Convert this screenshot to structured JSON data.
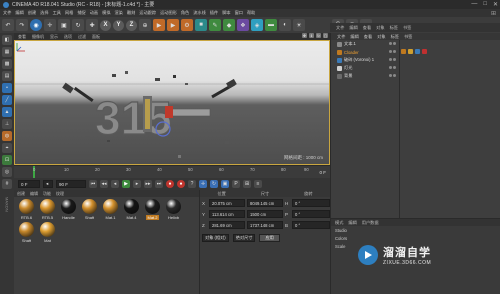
{
  "window": {
    "title": "CINEMA 4D R18.041 Studio (RC - R18) - [未标题-1.c4d *] - 主要",
    "controls": [
      "—",
      "□",
      "✕"
    ]
  },
  "menubar": [
    "文件",
    "编辑",
    "创建",
    "选择",
    "工具",
    "网格",
    "捕捉",
    "动画",
    "模拟",
    "渲染",
    "雕刻",
    "运动跟踪",
    "运动图形",
    "角色",
    "流水线",
    "插件",
    "脚本",
    "窗口",
    "帮助"
  ],
  "toolbar": {
    "xyz": [
      "X",
      "Y",
      "Z"
    ]
  },
  "viewport": {
    "menu": [
      "查看",
      "摄像机",
      "显示",
      "选项",
      "过滤",
      "面板"
    ],
    "grid_label": "网格间距 : 1000 cm",
    "text_3d": "315"
  },
  "timeline": {
    "ticks": [
      "0",
      "10",
      "20",
      "30",
      "40",
      "50",
      "60",
      "70",
      "80",
      "90"
    ],
    "current_frame": "0 F"
  },
  "transport": {
    "start_field": "0 F",
    "end_field": "90 F"
  },
  "materials": {
    "menu": [
      "创建",
      "编辑",
      "功能",
      "纹理"
    ],
    "items": [
      {
        "label": "RTB.6",
        "color": "#c98a2c"
      },
      {
        "label": "RTB.5",
        "color": "#d9962e"
      },
      {
        "label": "Handle",
        "color": "#1a1a1a"
      },
      {
        "label": "Shaft",
        "color": "#d18f2c"
      },
      {
        "label": "Mat.1",
        "color": "#d4922e"
      },
      {
        "label": "Mat.4",
        "color": "#141414"
      },
      {
        "label": "Mat.2",
        "color": "#1c1c1c"
      },
      {
        "label": "Helixb",
        "color": "#2a2a2a"
      },
      {
        "label": "Shaft",
        "color": "#c98a2c"
      },
      {
        "label": "Mat",
        "color": "#e0a032"
      }
    ],
    "selected_index": 6
  },
  "coordinates": {
    "headers": [
      "位置",
      "尺寸",
      "旋转"
    ],
    "rows": [
      {
        "axis": "X",
        "pos": "20.075 cm",
        "size": "8049.145 cm",
        "rotlabel": "H",
        "rot": "0 °"
      },
      {
        "axis": "Y",
        "pos": "113.614 cm",
        "size": "1500 cm",
        "rotlabel": "P",
        "rot": "0 °"
      },
      {
        "axis": "Z",
        "pos": "281.69 cm",
        "size": "1737.148 cm",
        "rotlabel": "B",
        "rot": "0 °"
      }
    ],
    "mode": "对象 (相对)",
    "size_mode": "绝对尺寸",
    "apply": "应用"
  },
  "object_manager": {
    "tabs": [
      "文件",
      "编辑",
      "查看",
      "对象",
      "标签",
      "书签"
    ],
    "menu": [
      "文件",
      "编辑",
      "查看",
      "对象",
      "标签",
      "书签"
    ],
    "objects": [
      {
        "name": "文本.1",
        "color": "#8a8a8a",
        "selected": false
      },
      {
        "name": "Cloader",
        "color": "#c07a20",
        "selected": true
      },
      {
        "name": "破碎 (Voronoi) 1",
        "color": "#3a7ab8",
        "selected": false
      },
      {
        "name": "灯光",
        "color": "#d0d0d0",
        "selected": false
      },
      {
        "name": "背景",
        "color": "#6a6a6a",
        "selected": false
      }
    ]
  },
  "attributes": {
    "tabs": [
      "模式",
      "编辑",
      "用户数据"
    ],
    "rows": [
      "Studio",
      "Colors",
      "Scale"
    ]
  },
  "watermark": {
    "main": "溜溜自学",
    "sub": "ZIXUE.3D66.COM"
  }
}
